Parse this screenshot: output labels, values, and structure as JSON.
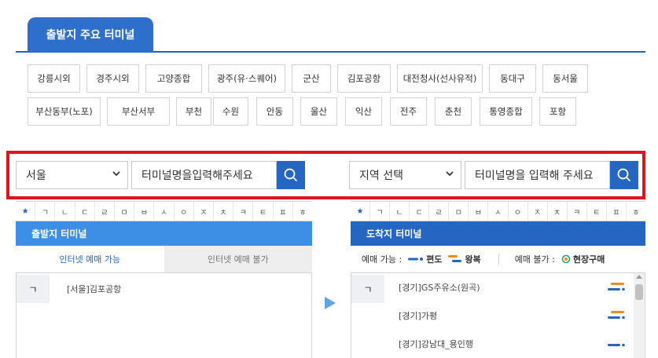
{
  "tab": {
    "label": "출발지 주요 터미널"
  },
  "chips_row1": [
    "강릉시외",
    "경주시외",
    "고양종합",
    "광주(유·스퀘어)",
    "군산",
    "김포공항",
    "대전청사(선사유적)",
    "동대구",
    "동서울"
  ],
  "chips_row2": [
    "부산동부(노포)",
    "부산서부",
    "부천",
    "수원",
    "안동",
    "울산",
    "익산",
    "전주",
    "춘천",
    "통영종합",
    "포항"
  ],
  "search": {
    "dep_region": "서울",
    "dep_input": "터미널명을입력해주세요",
    "arr_region": "지역 선택",
    "arr_input": "터미널명을 입력해 주세요"
  },
  "consonants": [
    "★",
    "ㄱ",
    "ㄴ",
    "ㄷ",
    "ㄹ",
    "ㅁ",
    "ㅂ",
    "ㅅ",
    "ㅇ",
    "ㅈ",
    "ㅊ",
    "ㅋ",
    "ㅌ",
    "ㅍ",
    "ㅎ"
  ],
  "departure": {
    "title": "출발지 터미널",
    "tab_online": "인터넷 예매 가능",
    "tab_offline": "인터넷 예매 불가",
    "initial": "ㄱ",
    "items": [
      "[서울]김포공항"
    ]
  },
  "arrival": {
    "title": "도착지 터미널",
    "legend_available": "예매 가능 :",
    "legend_oneway": "편도",
    "legend_round": "왕복",
    "legend_unavailable": "예매 불가 :",
    "legend_onsite": "현장구매",
    "initial": "ㄱ",
    "items": [
      "[경기]GS주유소(원곡)",
      "[경기]가평",
      "[경기]강남대_용인행"
    ]
  },
  "colors": {
    "primary": "#2566c2",
    "tab": "#2d6fcb",
    "dep_head": "#3c8fe4",
    "highlight": "#e0121b",
    "orange": "#f08a1c"
  }
}
